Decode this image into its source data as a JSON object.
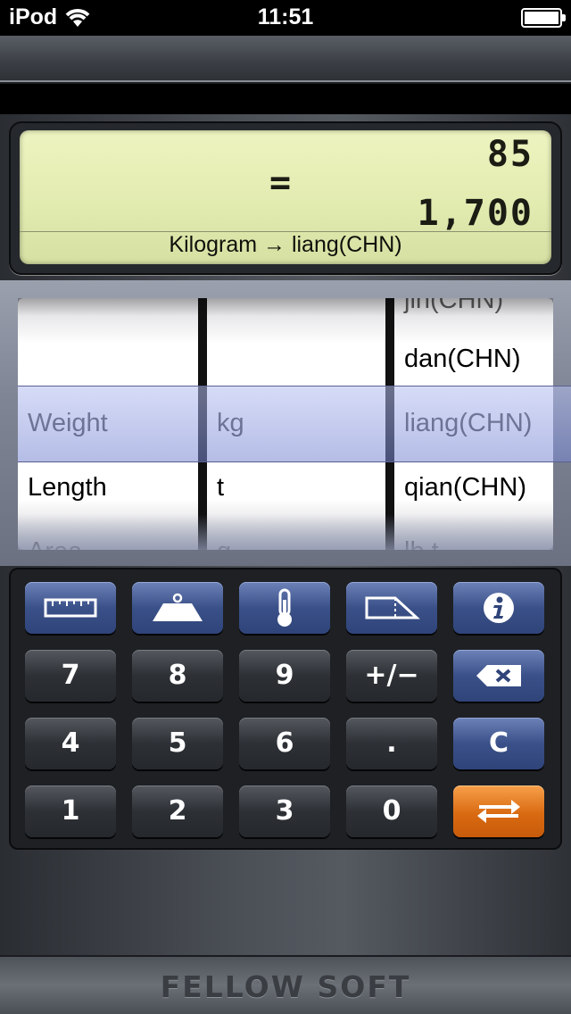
{
  "status_bar": {
    "carrier": "iPod",
    "time": "11:51"
  },
  "display": {
    "input_value": "85",
    "equals": "=",
    "result_value": "1,700",
    "conversion_label": "Kilogram → liang(CHN)"
  },
  "picker": {
    "category_column": {
      "rows": [
        "",
        "Weight",
        "Length",
        "Area"
      ],
      "selected": "Weight"
    },
    "from_unit_column": {
      "rows": [
        "",
        "kg",
        "t",
        "g"
      ],
      "selected": "kg"
    },
    "to_unit_column": {
      "rows": [
        "jin(CHN)",
        "dan(CHN)",
        "liang(CHN)",
        "qian(CHN)",
        "lb t"
      ],
      "selected": "liang(CHN)"
    }
  },
  "keypad": {
    "mode_keys": {
      "length_icon": "ruler-icon",
      "weight_icon": "weight-icon",
      "temperature_icon": "thermometer-icon",
      "area_icon": "area-icon",
      "info_icon": "info-icon"
    },
    "digits": {
      "seven": "7",
      "eight": "8",
      "nine": "9",
      "four": "4",
      "five": "5",
      "six": "6",
      "one": "1",
      "two": "2",
      "three": "3",
      "zero": "0"
    },
    "sign_label": "+/−",
    "decimal_label": ".",
    "clear_label": "C",
    "backspace_icon": "backspace-icon",
    "swap_icon": "swap-arrows-icon"
  },
  "footer": {
    "brand": "FELLOW SOFT"
  },
  "colors": {
    "lcd": "#e2ebb0",
    "blue_key": "#3a5088",
    "orange_key": "#d96a12",
    "selection": "#8a96d6"
  }
}
